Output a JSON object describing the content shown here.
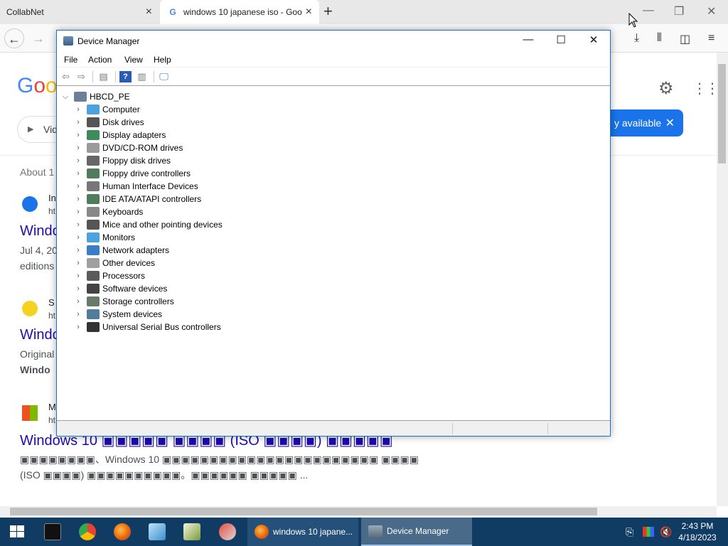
{
  "browser": {
    "tabs": [
      {
        "title": "CollabNet"
      },
      {
        "title": "windows 10 japanese iso - Goo"
      }
    ],
    "close_glyph": "×",
    "new_tab_glyph": "+",
    "window_controls": [
      "—",
      "❐",
      "✕"
    ],
    "toolbar_icons": [
      "download-icon",
      "library-icon",
      "sidebar-icon",
      "menu-icon"
    ]
  },
  "google": {
    "logo_letters": [
      "G",
      "o",
      "o"
    ],
    "chip_label": "Vid",
    "toast_text": "y available",
    "about_text": "About 1",
    "results": [
      {
        "site": "In",
        "url": "ht",
        "title": "Windo",
        "snippet_1": "Jul 4, 20",
        "snippet_2": "editions"
      },
      {
        "site": "S",
        "url": "ht",
        "title": "Windo",
        "snippet_1": "Original",
        "snippet_2": "Windo"
      },
      {
        "site": "M",
        "url": "ht",
        "title": "Windows 10 ▣▣▣▣▣ ▣▣▣▣ (ISO ▣▣▣▣) ▣▣▣▣▣",
        "snippet_1": "▣▣▣▣▣▣▣▣、Windows 10 ▣▣▣▣▣▣▣▣▣▣▣▣▣▣▣▣▣▣▣▣▣▣▣ ▣▣▣▣",
        "snippet_2": "(ISO ▣▣▣▣) ▣▣▣▣▣▣▣▣▣▣。▣▣▣▣▣▣ ▣▣▣▣▣ ..."
      }
    ]
  },
  "device_manager": {
    "title": "Device Manager",
    "controls": {
      "minimize": "—",
      "maximize": "☐",
      "close": "✕"
    },
    "menu": [
      "File",
      "Action",
      "View",
      "Help"
    ],
    "root": "HBCD_PE",
    "categories": [
      {
        "label": "Computer",
        "icon": "computer-icon",
        "color": "#4aa3df"
      },
      {
        "label": "Disk drives",
        "icon": "disk-drive-icon",
        "color": "#555555"
      },
      {
        "label": "Display adapters",
        "icon": "display-adapter-icon",
        "color": "#3d8b5a"
      },
      {
        "label": "DVD/CD-ROM drives",
        "icon": "dvd-drive-icon",
        "color": "#9a9a9a"
      },
      {
        "label": "Floppy disk drives",
        "icon": "floppy-drive-icon",
        "color": "#666666"
      },
      {
        "label": "Floppy drive controllers",
        "icon": "floppy-controller-icon",
        "color": "#4f7d5c"
      },
      {
        "label": "Human Interface Devices",
        "icon": "hid-icon",
        "color": "#777777"
      },
      {
        "label": "IDE ATA/ATAPI controllers",
        "icon": "ide-controller-icon",
        "color": "#4f7d5c"
      },
      {
        "label": "Keyboards",
        "icon": "keyboard-icon",
        "color": "#888888"
      },
      {
        "label": "Mice and other pointing devices",
        "icon": "mouse-icon",
        "color": "#555555"
      },
      {
        "label": "Monitors",
        "icon": "monitor-icon",
        "color": "#4aa3df"
      },
      {
        "label": "Network adapters",
        "icon": "network-adapter-icon",
        "color": "#3a7dc9"
      },
      {
        "label": "Other devices",
        "icon": "other-devices-icon",
        "color": "#a0a0a0"
      },
      {
        "label": "Processors",
        "icon": "processor-icon",
        "color": "#5a5a5a"
      },
      {
        "label": "Software devices",
        "icon": "software-device-icon",
        "color": "#444444"
      },
      {
        "label": "Storage controllers",
        "icon": "storage-controller-icon",
        "color": "#6a7a6a"
      },
      {
        "label": "System devices",
        "icon": "system-devices-icon",
        "color": "#4f7d9c"
      },
      {
        "label": "Universal Serial Bus controllers",
        "icon": "usb-controller-icon",
        "color": "#333333"
      }
    ]
  },
  "taskbar": {
    "tasks": [
      {
        "label": "windows 10 japane..."
      },
      {
        "label": "Device Manager"
      }
    ],
    "clock": {
      "time": "2:43 PM",
      "date": "4/18/2023"
    }
  }
}
